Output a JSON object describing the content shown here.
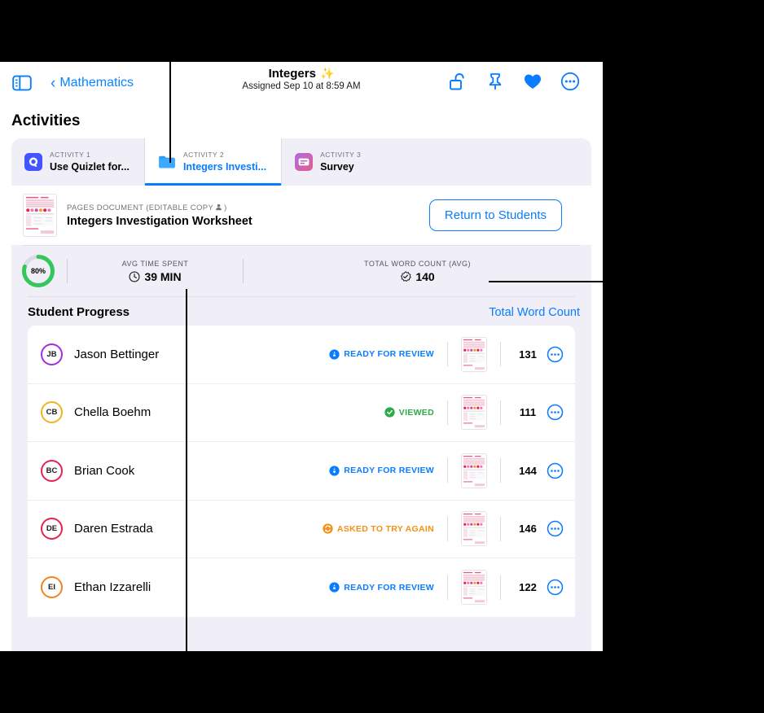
{
  "window": {
    "topbar": {
      "sidebar_toggle_icon": "sidebar-toggle-icon",
      "back_label": "Mathematics",
      "back_chevron": "‹",
      "title": "Integers",
      "title_sparkle": "✨",
      "subtitle": "Assigned Sep 10 at 8:59 AM",
      "icons": [
        {
          "name": "unlock-icon",
          "label": "Unlock"
        },
        {
          "name": "pin-icon",
          "label": "Pin"
        },
        {
          "name": "heart-icon",
          "label": "Favorite"
        },
        {
          "name": "more-circle-icon",
          "label": "More"
        }
      ]
    },
    "section_heading": "Activities",
    "tabs": [
      {
        "kicker": "ACTIVITY 1",
        "name": "Use Quizlet for...",
        "icon": "quizlet-app-icon",
        "active": false
      },
      {
        "kicker": "ACTIVITY 2",
        "name": "Integers Investi...",
        "icon": "folder-icon",
        "active": true
      },
      {
        "kicker": "ACTIVITY 3",
        "name": "Survey",
        "icon": "survey-app-icon",
        "active": false
      }
    ],
    "document": {
      "kicker": "PAGES DOCUMENT (EDITABLE COPY ",
      "kicker_person_icon": "person-icon",
      "kicker_close": ")",
      "title": "Integers Investigation Worksheet",
      "thumbnail_icon": "worksheet-thumbnail",
      "return_button": "Return to Students"
    },
    "stats": {
      "ring_percent_label": "80%",
      "ring_percent_value": 80,
      "ring_color": "#34c759",
      "items": [
        {
          "label": "AVG TIME SPENT",
          "value": "39 MIN",
          "icon": "clock-icon"
        },
        {
          "label": "TOTAL WORD COUNT (AVG)",
          "value": "140",
          "icon": "seal-check-icon"
        }
      ]
    },
    "progress": {
      "title": "Student Progress",
      "link": "Total Word Count"
    },
    "students": [
      {
        "initials": "JB",
        "name": "Jason Bettinger",
        "ring_color": "#a42ddf",
        "status": "READY FOR REVIEW",
        "status_color": "#0a7cff",
        "status_icon": "ready-badge-icon",
        "word_count": "131",
        "thumbnail_icon": "worksheet-thumbnail",
        "more_icon": "more-circle-icon"
      },
      {
        "initials": "CB",
        "name": "Chella Boehm",
        "ring_color": "#f0b323",
        "status": "VIEWED",
        "status_color": "#2aab4a",
        "status_icon": "viewed-check-icon",
        "word_count": "111",
        "thumbnail_icon": "worksheet-thumbnail",
        "more_icon": "more-circle-icon"
      },
      {
        "initials": "BC",
        "name": "Brian Cook",
        "ring_color": "#e8224e",
        "status": "READY FOR REVIEW",
        "status_color": "#0a7cff",
        "status_icon": "ready-badge-icon",
        "word_count": "144",
        "thumbnail_icon": "worksheet-thumbnail",
        "more_icon": "more-circle-icon"
      },
      {
        "initials": "DE",
        "name": "Daren Estrada",
        "ring_color": "#e8224e",
        "status": "ASKED TO TRY AGAIN",
        "status_color": "#f59017",
        "status_icon": "retry-arrows-icon",
        "word_count": "146",
        "thumbnail_icon": "worksheet-thumbnail",
        "more_icon": "more-circle-icon"
      },
      {
        "initials": "EI",
        "name": "Ethan Izzarelli",
        "ring_color": "#f58220",
        "status": "READY FOR REVIEW",
        "status_color": "#0a7cff",
        "status_icon": "ready-badge-icon",
        "word_count": "122",
        "thumbnail_icon": "worksheet-thumbnail",
        "more_icon": "more-circle-icon"
      }
    ]
  },
  "theme": {
    "accent_blue": "#0a7cff",
    "panel_lavender": "#f0eff7",
    "green": "#34c759",
    "orange": "#f59017",
    "backdrop": "#000000"
  }
}
